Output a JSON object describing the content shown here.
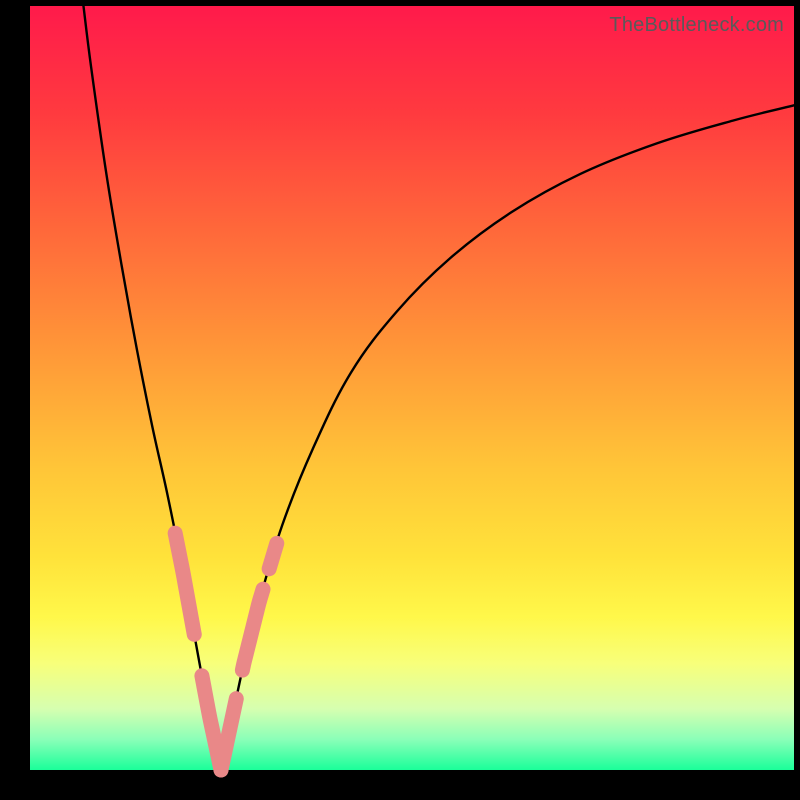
{
  "watermark": "TheBottleneck.com",
  "gradient": {
    "stops": [
      {
        "pct": 0,
        "color": "#ff1a4b"
      },
      {
        "pct": 14,
        "color": "#ff3a3f"
      },
      {
        "pct": 30,
        "color": "#ff6a3a"
      },
      {
        "pct": 46,
        "color": "#ff9a38"
      },
      {
        "pct": 60,
        "color": "#ffc438"
      },
      {
        "pct": 72,
        "color": "#ffe23a"
      },
      {
        "pct": 80,
        "color": "#fff84a"
      },
      {
        "pct": 86,
        "color": "#f8ff7a"
      },
      {
        "pct": 92,
        "color": "#d6ffb0"
      },
      {
        "pct": 96,
        "color": "#8affb8"
      },
      {
        "pct": 100,
        "color": "#1aff9a"
      }
    ]
  },
  "marker_color": "#e98888",
  "chart_data": {
    "type": "line",
    "title": "",
    "xlabel": "",
    "ylabel": "",
    "xlim": [
      0,
      100
    ],
    "ylim": [
      0,
      100
    ],
    "series": [
      {
        "name": "left-branch",
        "x": [
          7,
          8,
          10,
          12,
          14,
          16,
          18,
          20,
          22,
          23.5,
          25
        ],
        "values": [
          100,
          92,
          78,
          66,
          55,
          45,
          36,
          26,
          15,
          7,
          0
        ]
      },
      {
        "name": "right-branch",
        "x": [
          25,
          26.5,
          28,
          30,
          33,
          37,
          42,
          48,
          55,
          63,
          72,
          82,
          92,
          100
        ],
        "values": [
          0,
          7,
          14,
          22,
          32,
          42,
          52,
          60,
          67,
          73,
          78,
          82,
          85,
          87
        ]
      }
    ],
    "highlight_zone_y": [
      0,
      28
    ],
    "highlight_segments": [
      {
        "branch": "left-branch",
        "x_from": 19.0,
        "x_to": 21.5
      },
      {
        "branch": "left-branch",
        "x_from": 22.5,
        "x_to": 25.0
      },
      {
        "branch": "right-branch",
        "x_from": 25.0,
        "x_to": 27.0
      },
      {
        "branch": "right-branch",
        "x_from": 27.8,
        "x_to": 30.5
      },
      {
        "branch": "right-branch",
        "x_from": 31.3,
        "x_to": 32.3
      }
    ]
  }
}
